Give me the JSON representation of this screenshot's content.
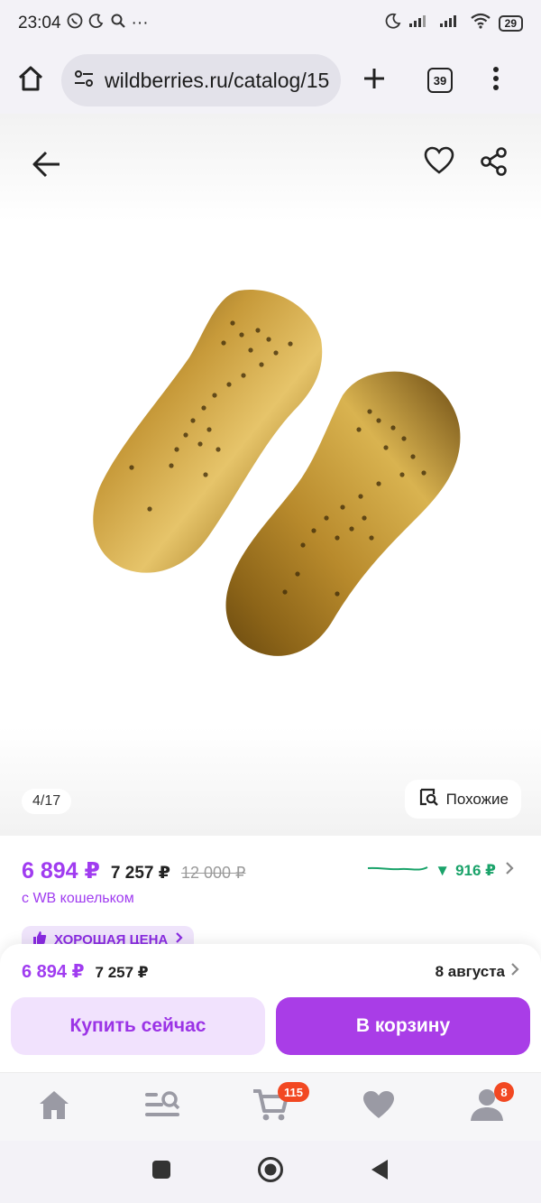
{
  "status_bar": {
    "time": "23:04",
    "extra": "···",
    "battery": "29"
  },
  "browser": {
    "url": "wildberries.ru/catalog/15",
    "tab_count": "39"
  },
  "gallery": {
    "counter": "4/17",
    "similar_label": "Похожие"
  },
  "price": {
    "main": "6 894 ₽",
    "wb_wallet_price": "7 257 ₽",
    "old": "12 000 ₽",
    "drop": "916 ₽",
    "wallet_note": "с WB кошельком",
    "badge": "ХОРОШАЯ ЦЕНА"
  },
  "buy_panel": {
    "price_main": "6 894 ₽",
    "price_wb": "7 257 ₽",
    "delivery_date": "8 августа",
    "buy_now_label": "Купить сейчас",
    "add_to_cart_label": "В корзину"
  },
  "bottom_nav": {
    "cart_count": "115",
    "profile_count": "8"
  },
  "colors": {
    "accent": "#a03cf0",
    "cart_button": "#a93de7",
    "price_drop": "#1aa36a",
    "badge_red": "#f24822"
  }
}
